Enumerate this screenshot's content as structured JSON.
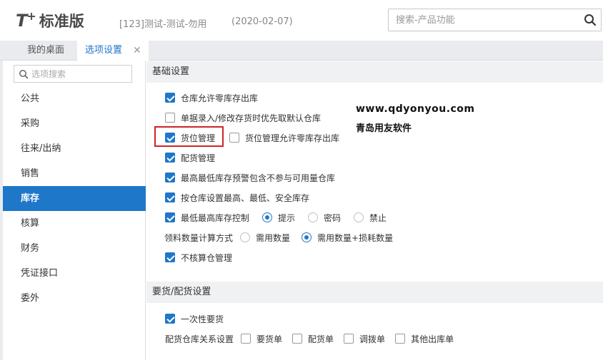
{
  "header": {
    "logo_t": "T",
    "logo_plus": "+",
    "logo_name": "标准版",
    "account": "[123]测试-测试-勿用",
    "date": "(2020-02-07)",
    "search_placeholder": "搜索-产品功能"
  },
  "tabs": {
    "home": "我的桌面",
    "active": "选项设置",
    "close": "✕"
  },
  "sidebar": {
    "search_placeholder": "选项搜索",
    "items": [
      "公共",
      "采购",
      "往来/出纳",
      "销售",
      "库存",
      "核算",
      "财务",
      "凭证接口",
      "委外"
    ],
    "active_index": 4
  },
  "sections": {
    "basic": "基础设置",
    "request": "要货/配货设置"
  },
  "options": {
    "o1": {
      "label": "仓库允许零库存出库",
      "checked": true
    },
    "o2": {
      "label": "单据录入/修改存货时优先取默认仓库",
      "checked": false
    },
    "o3": {
      "label": "货位管理",
      "checked": true
    },
    "o3b": {
      "label": "货位管理允许零库存出库",
      "checked": false
    },
    "o4": {
      "label": "配货管理",
      "checked": true
    },
    "o5": {
      "label": "最高最低库存预警包含不参与可用量仓库",
      "checked": true
    },
    "o6": {
      "label": "按仓库设置最高、最低、安全库存",
      "checked": true
    },
    "o7": {
      "label": "最低最高库存控制",
      "checked": true
    },
    "o7_radios": [
      {
        "label": "提示",
        "selected": true
      },
      {
        "label": "密码",
        "selected": false
      },
      {
        "label": "禁止",
        "selected": false
      }
    ],
    "o8_label": "领料数量计算方式",
    "o8_radios": [
      {
        "label": "需用数量",
        "selected": false
      },
      {
        "label": "需用数量+损耗数量",
        "selected": true
      }
    ],
    "o9": {
      "label": "不核算仓管理",
      "checked": true
    },
    "r1": {
      "label": "一次性要货",
      "checked": true
    },
    "r2_label": "配货仓库关系设置",
    "r2_boxes": [
      {
        "label": "要货单",
        "checked": false
      },
      {
        "label": "配货单",
        "checked": false
      },
      {
        "label": "调拨单",
        "checked": false
      },
      {
        "label": "其他出库单",
        "checked": false
      }
    ]
  },
  "watermark": {
    "url": "www.qdyonyou.com",
    "name": "青岛用友软件"
  },
  "colors": {
    "accent": "#1f77c9",
    "highlight": "#d32323"
  }
}
